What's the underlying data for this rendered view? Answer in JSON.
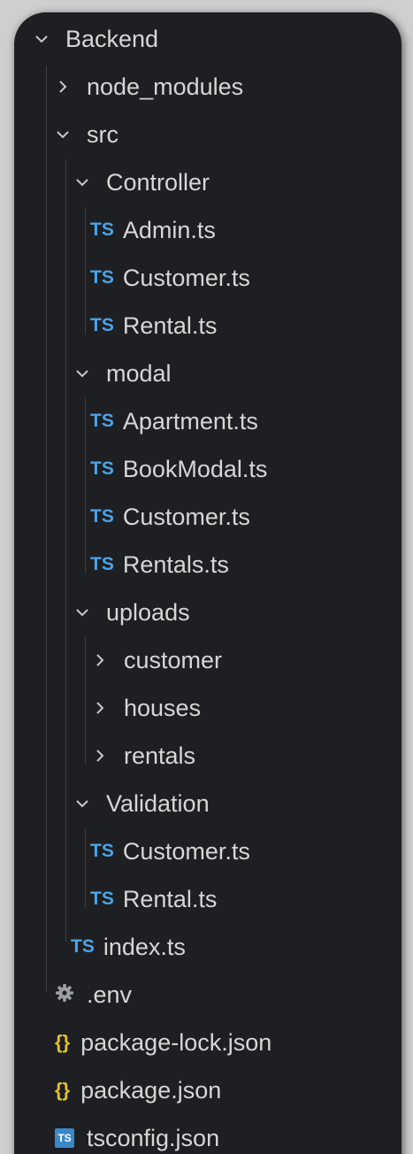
{
  "explorer": {
    "root": {
      "label": "Backend",
      "expanded": true
    },
    "items": [
      {
        "label": "node_modules"
      },
      {
        "label": "src"
      },
      {
        "label": "Controller"
      },
      {
        "label": "Admin.ts",
        "badge": "TS"
      },
      {
        "label": "Customer.ts",
        "badge": "TS"
      },
      {
        "label": "Rental.ts",
        "badge": "TS"
      },
      {
        "label": "modal"
      },
      {
        "label": "Apartment.ts",
        "badge": "TS"
      },
      {
        "label": "BookModal.ts",
        "badge": "TS"
      },
      {
        "label": "Customer.ts",
        "badge": "TS"
      },
      {
        "label": "Rentals.ts",
        "badge": "TS"
      },
      {
        "label": "uploads"
      },
      {
        "label": "customer"
      },
      {
        "label": "houses"
      },
      {
        "label": "rentals"
      },
      {
        "label": "Validation"
      },
      {
        "label": "Customer.ts",
        "badge": "TS"
      },
      {
        "label": "Rental.ts",
        "badge": "TS"
      },
      {
        "label": "index.ts",
        "badge": "TS"
      },
      {
        "label": ".env"
      },
      {
        "label": "package-lock.json",
        "badge": "{}"
      },
      {
        "label": "package.json",
        "badge": "{}"
      },
      {
        "label": "tsconfig.json",
        "badge": "TS"
      }
    ]
  },
  "colors": {
    "background": "#1e1f22",
    "text": "#d6d6d6",
    "ts_badge": "#4aa3e6",
    "json_braces": "#e4c02e",
    "tsconfig_icon": "#3b88c8"
  }
}
